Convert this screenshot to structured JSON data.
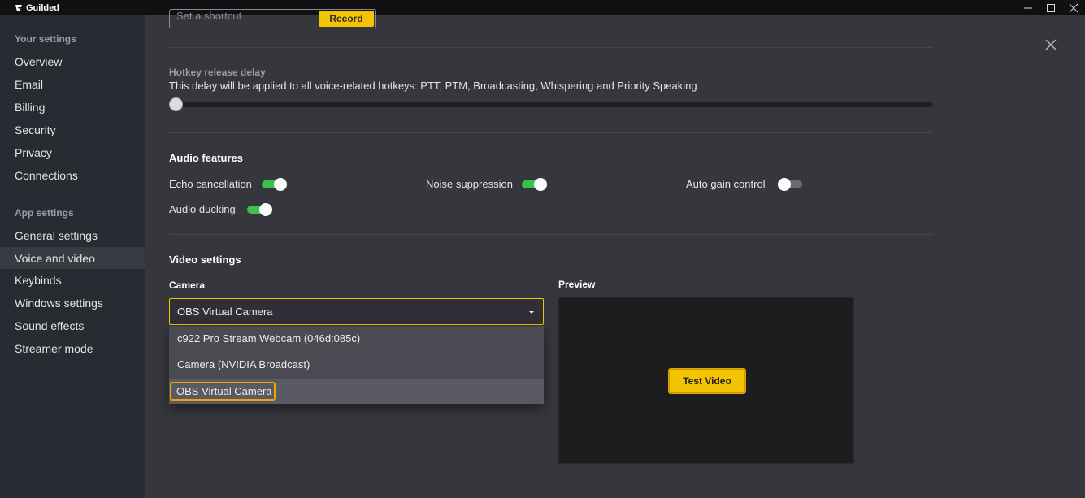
{
  "titlebar": {
    "app_name": "Guilded"
  },
  "sidebar": {
    "your_settings_heading": "Your settings",
    "your_settings_items": [
      {
        "label": "Overview"
      },
      {
        "label": "Email"
      },
      {
        "label": "Billing"
      },
      {
        "label": "Security"
      },
      {
        "label": "Privacy"
      },
      {
        "label": "Connections"
      }
    ],
    "app_settings_heading": "App settings",
    "app_settings_items": [
      {
        "label": "General settings"
      },
      {
        "label": "Voice and video",
        "active": true
      },
      {
        "label": "Keybinds"
      },
      {
        "label": "Windows settings"
      },
      {
        "label": "Sound effects"
      },
      {
        "label": "Streamer mode"
      }
    ]
  },
  "shortcut": {
    "placeholder": "Set a shortcut",
    "record_label": "Record"
  },
  "hotkey_delay": {
    "title": "Hotkey release delay",
    "description": "This delay will be applied to all voice-related hotkeys: PTT, PTM, Broadcasting, Whispering and Priority Speaking",
    "value_fraction": 0
  },
  "audio_features": {
    "title": "Audio features",
    "toggles": [
      {
        "label": "Echo cancellation",
        "on": true
      },
      {
        "label": "Noise suppression",
        "on": true
      },
      {
        "label": "Auto gain control",
        "on": false
      },
      {
        "label": "Audio ducking",
        "on": true
      }
    ]
  },
  "video_settings": {
    "title": "Video settings",
    "camera_label": "Camera",
    "camera_selected": "OBS Virtual Camera",
    "camera_options": [
      "c922 Pro Stream Webcam (046d:085c)",
      "Camera (NVIDIA Broadcast)",
      "OBS Virtual Camera"
    ],
    "preview_label": "Preview",
    "test_video_label": "Test Video"
  },
  "colors": {
    "accent": "#f5c400",
    "toggle_on": "#3bc24b",
    "sidebar_bg": "#292b32",
    "main_bg": "#36363d"
  }
}
